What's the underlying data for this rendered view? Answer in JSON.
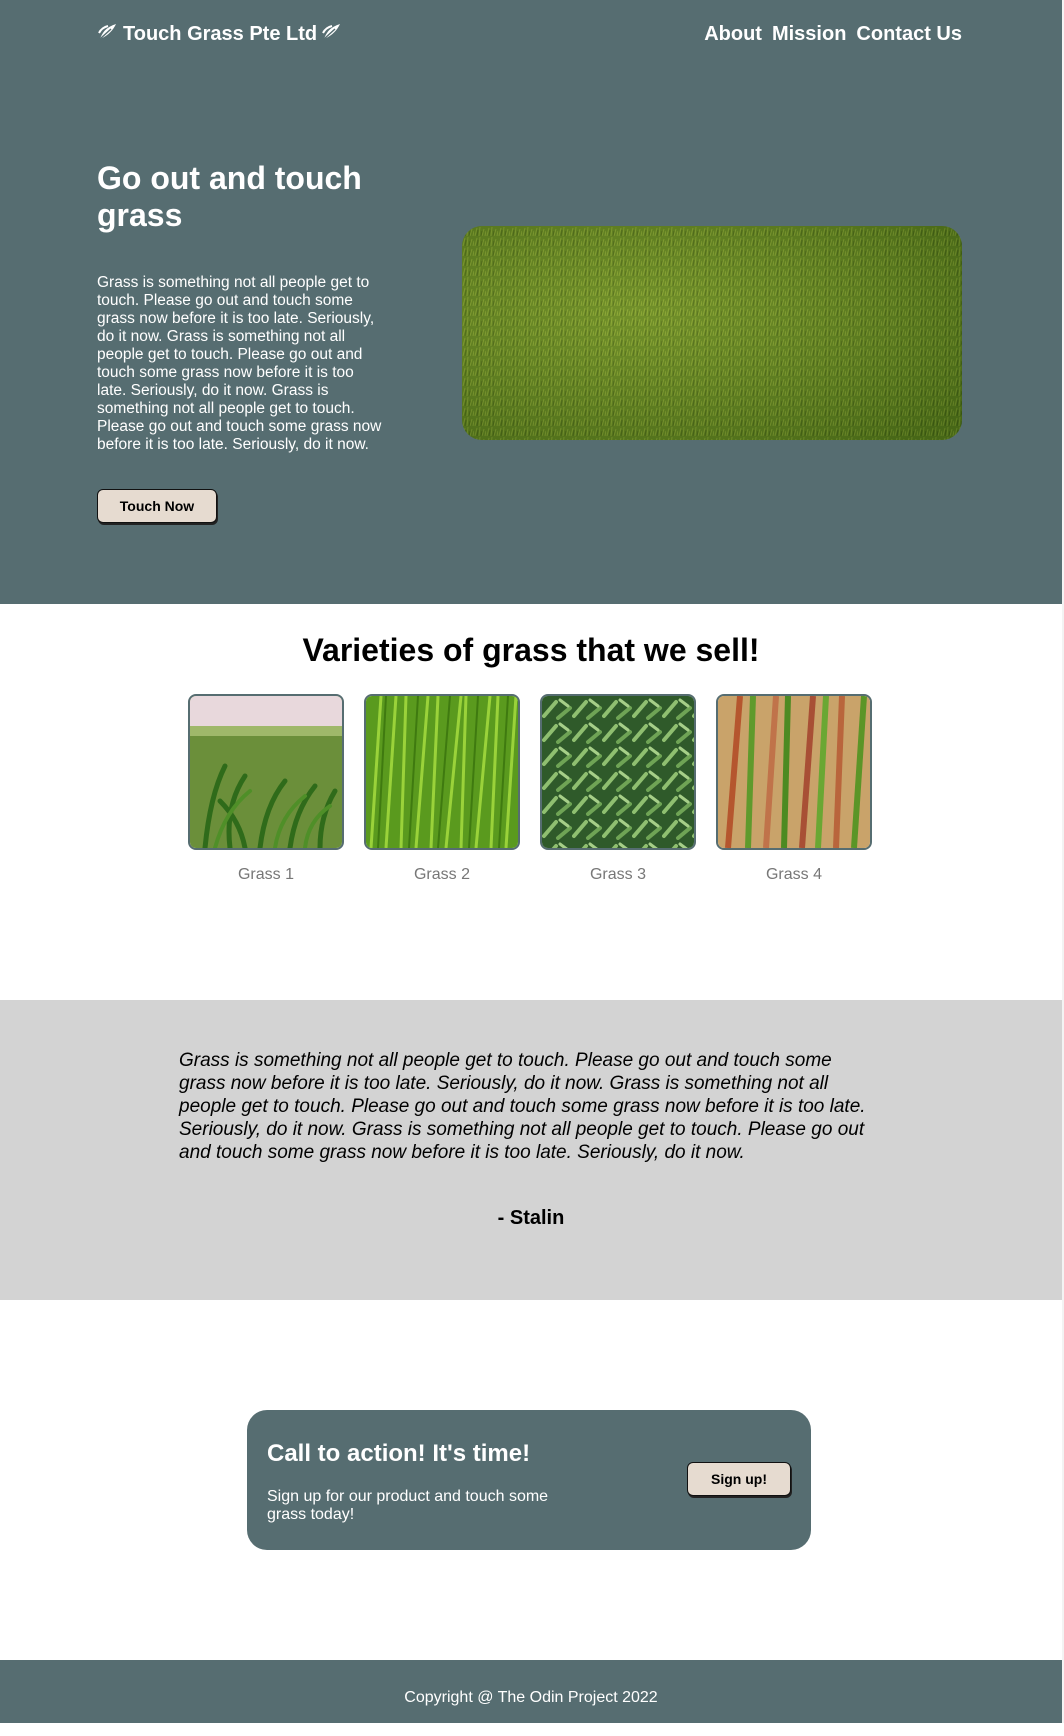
{
  "header": {
    "brand": "Touch Grass Pte Ltd",
    "nav": [
      {
        "label": "About"
      },
      {
        "label": "Mission"
      },
      {
        "label": "Contact Us"
      }
    ]
  },
  "hero": {
    "title": "Go out and touch grass",
    "body": "Grass is something not all people get to touch. Please go out and touch some grass now before it is too late. Seriously, do it now. Grass is something not all people get to touch. Please go out and touch some grass now before it is too late. Seriously, do it now. Grass is something not all people get to touch. Please go out and touch some grass now before it is too late. Seriously, do it now.",
    "button_label": "Touch Now"
  },
  "varieties": {
    "title": "Varieties of grass that we sell!",
    "items": [
      {
        "label": "Grass 1"
      },
      {
        "label": "Grass 2"
      },
      {
        "label": "Grass 3"
      },
      {
        "label": "Grass 4"
      }
    ]
  },
  "quote": {
    "text": "Grass is something not all people get to touch. Please go out and touch some grass now before it is too late. Seriously, do it now. Grass is something not all people get to touch. Please go out and touch some grass now before it is too late. Seriously, do it now. Grass is something not all people get to touch. Please go out and touch some grass now before it is too late. Seriously, do it now.",
    "author": "- Stalin"
  },
  "cta": {
    "title": "Call to action! It's time!",
    "text": "Sign up for our product and touch some grass today!",
    "button_label": "Sign up!"
  },
  "footer": {
    "text": "Copyright @ The Odin Project 2022"
  },
  "colors": {
    "accent": "#566d71",
    "button_bg": "#e6dbd0",
    "quote_bg": "#d3d3d3"
  }
}
